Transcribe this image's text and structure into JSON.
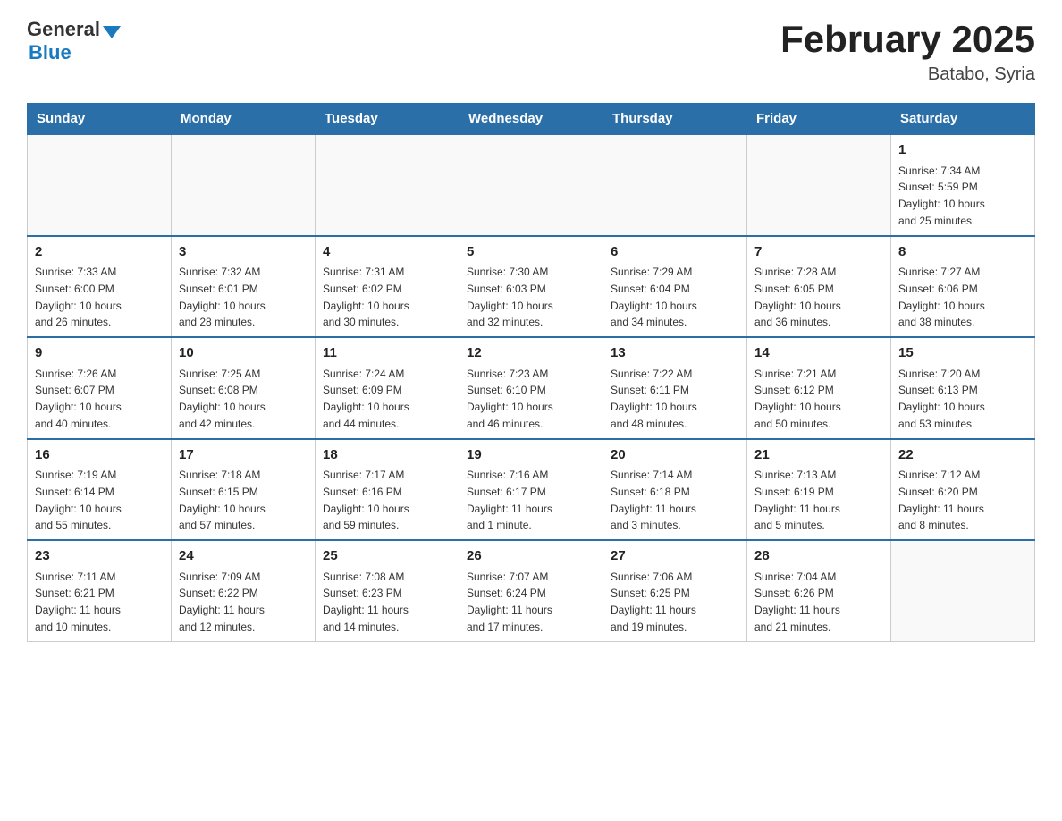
{
  "header": {
    "logo_general": "General",
    "logo_blue": "Blue",
    "title": "February 2025",
    "subtitle": "Batabo, Syria"
  },
  "calendar": {
    "days_of_week": [
      "Sunday",
      "Monday",
      "Tuesday",
      "Wednesday",
      "Thursday",
      "Friday",
      "Saturday"
    ],
    "weeks": [
      [
        {
          "day": "",
          "info": ""
        },
        {
          "day": "",
          "info": ""
        },
        {
          "day": "",
          "info": ""
        },
        {
          "day": "",
          "info": ""
        },
        {
          "day": "",
          "info": ""
        },
        {
          "day": "",
          "info": ""
        },
        {
          "day": "1",
          "info": "Sunrise: 7:34 AM\nSunset: 5:59 PM\nDaylight: 10 hours\nand 25 minutes."
        }
      ],
      [
        {
          "day": "2",
          "info": "Sunrise: 7:33 AM\nSunset: 6:00 PM\nDaylight: 10 hours\nand 26 minutes."
        },
        {
          "day": "3",
          "info": "Sunrise: 7:32 AM\nSunset: 6:01 PM\nDaylight: 10 hours\nand 28 minutes."
        },
        {
          "day": "4",
          "info": "Sunrise: 7:31 AM\nSunset: 6:02 PM\nDaylight: 10 hours\nand 30 minutes."
        },
        {
          "day": "5",
          "info": "Sunrise: 7:30 AM\nSunset: 6:03 PM\nDaylight: 10 hours\nand 32 minutes."
        },
        {
          "day": "6",
          "info": "Sunrise: 7:29 AM\nSunset: 6:04 PM\nDaylight: 10 hours\nand 34 minutes."
        },
        {
          "day": "7",
          "info": "Sunrise: 7:28 AM\nSunset: 6:05 PM\nDaylight: 10 hours\nand 36 minutes."
        },
        {
          "day": "8",
          "info": "Sunrise: 7:27 AM\nSunset: 6:06 PM\nDaylight: 10 hours\nand 38 minutes."
        }
      ],
      [
        {
          "day": "9",
          "info": "Sunrise: 7:26 AM\nSunset: 6:07 PM\nDaylight: 10 hours\nand 40 minutes."
        },
        {
          "day": "10",
          "info": "Sunrise: 7:25 AM\nSunset: 6:08 PM\nDaylight: 10 hours\nand 42 minutes."
        },
        {
          "day": "11",
          "info": "Sunrise: 7:24 AM\nSunset: 6:09 PM\nDaylight: 10 hours\nand 44 minutes."
        },
        {
          "day": "12",
          "info": "Sunrise: 7:23 AM\nSunset: 6:10 PM\nDaylight: 10 hours\nand 46 minutes."
        },
        {
          "day": "13",
          "info": "Sunrise: 7:22 AM\nSunset: 6:11 PM\nDaylight: 10 hours\nand 48 minutes."
        },
        {
          "day": "14",
          "info": "Sunrise: 7:21 AM\nSunset: 6:12 PM\nDaylight: 10 hours\nand 50 minutes."
        },
        {
          "day": "15",
          "info": "Sunrise: 7:20 AM\nSunset: 6:13 PM\nDaylight: 10 hours\nand 53 minutes."
        }
      ],
      [
        {
          "day": "16",
          "info": "Sunrise: 7:19 AM\nSunset: 6:14 PM\nDaylight: 10 hours\nand 55 minutes."
        },
        {
          "day": "17",
          "info": "Sunrise: 7:18 AM\nSunset: 6:15 PM\nDaylight: 10 hours\nand 57 minutes."
        },
        {
          "day": "18",
          "info": "Sunrise: 7:17 AM\nSunset: 6:16 PM\nDaylight: 10 hours\nand 59 minutes."
        },
        {
          "day": "19",
          "info": "Sunrise: 7:16 AM\nSunset: 6:17 PM\nDaylight: 11 hours\nand 1 minute."
        },
        {
          "day": "20",
          "info": "Sunrise: 7:14 AM\nSunset: 6:18 PM\nDaylight: 11 hours\nand 3 minutes."
        },
        {
          "day": "21",
          "info": "Sunrise: 7:13 AM\nSunset: 6:19 PM\nDaylight: 11 hours\nand 5 minutes."
        },
        {
          "day": "22",
          "info": "Sunrise: 7:12 AM\nSunset: 6:20 PM\nDaylight: 11 hours\nand 8 minutes."
        }
      ],
      [
        {
          "day": "23",
          "info": "Sunrise: 7:11 AM\nSunset: 6:21 PM\nDaylight: 11 hours\nand 10 minutes."
        },
        {
          "day": "24",
          "info": "Sunrise: 7:09 AM\nSunset: 6:22 PM\nDaylight: 11 hours\nand 12 minutes."
        },
        {
          "day": "25",
          "info": "Sunrise: 7:08 AM\nSunset: 6:23 PM\nDaylight: 11 hours\nand 14 minutes."
        },
        {
          "day": "26",
          "info": "Sunrise: 7:07 AM\nSunset: 6:24 PM\nDaylight: 11 hours\nand 17 minutes."
        },
        {
          "day": "27",
          "info": "Sunrise: 7:06 AM\nSunset: 6:25 PM\nDaylight: 11 hours\nand 19 minutes."
        },
        {
          "day": "28",
          "info": "Sunrise: 7:04 AM\nSunset: 6:26 PM\nDaylight: 11 hours\nand 21 minutes."
        },
        {
          "day": "",
          "info": ""
        }
      ]
    ]
  }
}
